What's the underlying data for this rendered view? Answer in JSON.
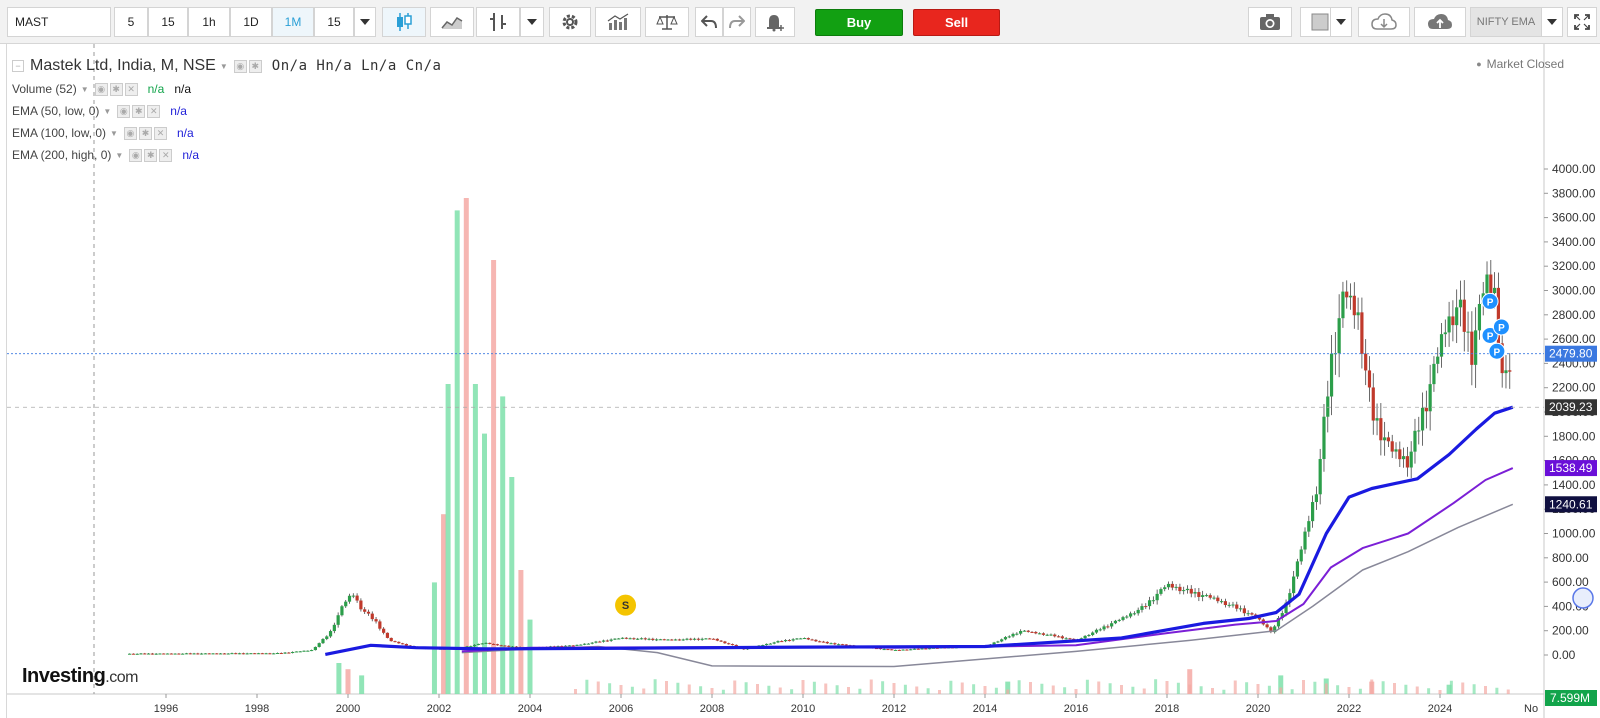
{
  "toolbar": {
    "symbol": "MAST",
    "timeframes": [
      "5",
      "15",
      "1h",
      "1D",
      "1M",
      "15"
    ],
    "active_timeframe": "1M",
    "buy_label": "Buy",
    "sell_label": "Sell",
    "compare_label": "NIFTY EMA",
    "buy_color": "#12a012",
    "sell_color": "#e8261e"
  },
  "legend": {
    "title": "Mastek Ltd, India, M, NSE",
    "ohlc": "On/a  Hn/a  Ln/a  Cn/a",
    "indicators": [
      {
        "label": "Volume (52)",
        "v1": "n/a",
        "v2": "n/a",
        "c1": "#12a44b",
        "c2": "#111111"
      },
      {
        "label": "EMA (50, low, 0)",
        "v1": "n/a",
        "c1": "#1e1ed8"
      },
      {
        "label": "EMA (100, low, 0)",
        "v1": "n/a",
        "c1": "#1e1ed8"
      },
      {
        "label": "EMA (200, high, 0)",
        "v1": "n/a",
        "c1": "#1e1ed8"
      }
    ]
  },
  "status": {
    "market": "Market Closed"
  },
  "branding": {
    "logo": "Investing",
    "logo_suffix": ".com"
  },
  "chart_data": {
    "type": "candlestick",
    "title": "Mastek Ltd, India, M, NSE",
    "ylim": [
      -100,
      4100
    ],
    "y_ticks": [
      0,
      200,
      400,
      600,
      800,
      1000,
      1200,
      1400,
      1600,
      1800,
      2000,
      2200,
      2400,
      2600,
      2800,
      3000,
      3200,
      3400,
      3600,
      3800,
      4000
    ],
    "y_tick_labels": [
      "0.00",
      "200.00",
      "400.00",
      "600.00",
      "800.00",
      "1000.00",
      "1200.00",
      "1400.00",
      "1600.00",
      "1800.00",
      "2000.00",
      "2200.00",
      "2400.00",
      "2600.00",
      "2800.00",
      "3000.00",
      "3200.00",
      "3400.00",
      "3600.00",
      "3800.00",
      "4000.00"
    ],
    "x_ticks": [
      1996,
      1998,
      2000,
      2002,
      2004,
      2006,
      2008,
      2010,
      2012,
      2014,
      2016,
      2018,
      2020,
      2022,
      2024
    ],
    "x_tick_labels": [
      "1996",
      "1998",
      "2000",
      "2002",
      "2004",
      "2006",
      "2008",
      "2010",
      "2012",
      "2014",
      "2016",
      "2018",
      "2020",
      "2022",
      "2024",
      "No"
    ],
    "xlim": [
      1994.9,
      2025.9
    ],
    "price_points": [
      [
        1995.2,
        10
      ],
      [
        1997.0,
        12
      ],
      [
        1998.5,
        14
      ],
      [
        1999.2,
        40
      ],
      [
        1999.6,
        180
      ],
      [
        1999.9,
        420
      ],
      [
        2000.1,
        510
      ],
      [
        2000.3,
        380
      ],
      [
        2000.6,
        280
      ],
      [
        2000.9,
        120
      ],
      [
        2001.5,
        60
      ],
      [
        2002.0,
        50
      ],
      [
        2002.5,
        60
      ],
      [
        2003.0,
        100
      ],
      [
        2003.5,
        70
      ],
      [
        2004.0,
        60
      ],
      [
        2005.0,
        80
      ],
      [
        2006.0,
        140
      ],
      [
        2007.0,
        125
      ],
      [
        2008.0,
        135
      ],
      [
        2008.7,
        50
      ],
      [
        2009.5,
        115
      ],
      [
        2010.0,
        140
      ],
      [
        2010.5,
        100
      ],
      [
        2011.0,
        80
      ],
      [
        2012.0,
        40
      ],
      [
        2013.0,
        60
      ],
      [
        2014.0,
        70
      ],
      [
        2014.8,
        200
      ],
      [
        2015.5,
        160
      ],
      [
        2016.0,
        120
      ],
      [
        2017.0,
        300
      ],
      [
        2017.5,
        400
      ],
      [
        2018.0,
        580
      ],
      [
        2018.6,
        510
      ],
      [
        2019.0,
        470
      ],
      [
        2019.6,
        380
      ],
      [
        2020.0,
        300
      ],
      [
        2020.3,
        190
      ],
      [
        2020.6,
        400
      ],
      [
        2020.9,
        800
      ],
      [
        2021.3,
        1400
      ],
      [
        2021.6,
        2400
      ],
      [
        2021.9,
        3000
      ],
      [
        2022.2,
        2800
      ],
      [
        2022.5,
        2000
      ],
      [
        2022.9,
        1700
      ],
      [
        2023.3,
        1600
      ],
      [
        2023.7,
        2100
      ],
      [
        2024.1,
        2700
      ],
      [
        2024.4,
        2900
      ],
      [
        2024.7,
        2500
      ],
      [
        2025.0,
        3100
      ],
      [
        2025.2,
        3000
      ],
      [
        2025.4,
        2200
      ],
      [
        2025.6,
        2480
      ]
    ],
    "ema_50_points": [
      [
        1999.5,
        5
      ],
      [
        2000.5,
        80
      ],
      [
        2001.5,
        60
      ],
      [
        2003,
        50
      ],
      [
        2006,
        55
      ],
      [
        2010,
        65
      ],
      [
        2014,
        70
      ],
      [
        2017,
        140
      ],
      [
        2018.8,
        260
      ],
      [
        2019.8,
        300
      ],
      [
        2020.4,
        350
      ],
      [
        2020.9,
        500
      ],
      [
        2021.5,
        1000
      ],
      [
        2022.0,
        1300
      ],
      [
        2022.5,
        1370
      ],
      [
        2023.5,
        1450
      ],
      [
        2024.2,
        1650
      ],
      [
        2024.8,
        1860
      ],
      [
        2025.2,
        1990
      ],
      [
        2025.6,
        2039.23
      ]
    ],
    "ema_100_points": [
      [
        2002.5,
        30
      ],
      [
        2004,
        60
      ],
      [
        2008,
        65
      ],
      [
        2012,
        60
      ],
      [
        2016,
        80
      ],
      [
        2018.0,
        180
      ],
      [
        2019.5,
        250
      ],
      [
        2020.4,
        280
      ],
      [
        2021.0,
        420
      ],
      [
        2021.6,
        720
      ],
      [
        2022.3,
        880
      ],
      [
        2023.3,
        1000
      ],
      [
        2024.3,
        1250
      ],
      [
        2025.0,
        1440
      ],
      [
        2025.6,
        1538.49
      ]
    ],
    "ema_200_points": [
      [
        2002.5,
        20
      ],
      [
        2003.5,
        40
      ],
      [
        2005.5,
        70
      ],
      [
        2006.8,
        20
      ],
      [
        2008,
        -90
      ],
      [
        2012,
        -95
      ],
      [
        2016,
        30
      ],
      [
        2018.5,
        120
      ],
      [
        2020.4,
        200
      ],
      [
        2021.2,
        400
      ],
      [
        2022.3,
        700
      ],
      [
        2023.3,
        850
      ],
      [
        2024.4,
        1050
      ],
      [
        2025.6,
        1240.61
      ]
    ],
    "price_markers": [
      {
        "label": "2479.80",
        "value": 2479.8,
        "color": "#3a78e0"
      },
      {
        "label": "2039.23",
        "value": 2039.23,
        "color": "#333333"
      },
      {
        "label": "1538.49",
        "value": 1538.49,
        "color": "#6a0fd8"
      },
      {
        "label": "1240.61",
        "value": 1240.61,
        "color": "#101040"
      }
    ],
    "volume_marker": {
      "label": "7.599M",
      "color": "#12a44b"
    },
    "event_markers": [
      {
        "label": "S",
        "year": 2006.1,
        "value": 410,
        "color": "#f4c400"
      },
      {
        "label": "P",
        "year": 2025.1,
        "value": 2910,
        "color": "#1e90ff"
      },
      {
        "label": "P",
        "year": 2025.1,
        "value": 2630,
        "color": "#1e90ff"
      },
      {
        "label": "P",
        "year": 2025.35,
        "value": 2700,
        "color": "#1e90ff"
      },
      {
        "label": "P",
        "year": 2025.25,
        "value": 2500,
        "color": "#1e90ff"
      }
    ],
    "volume_bars": [
      [
        2001.9,
        180
      ],
      [
        2002.1,
        290
      ],
      [
        2002.2,
        500
      ],
      [
        2002.4,
        780
      ],
      [
        2002.6,
        800
      ],
      [
        2002.8,
        500
      ],
      [
        2003.0,
        420
      ],
      [
        2003.2,
        700
      ],
      [
        2003.4,
        480
      ],
      [
        2003.6,
        350
      ],
      [
        2003.8,
        200
      ],
      [
        2004.0,
        120
      ],
      [
        1999.8,
        50
      ],
      [
        2000.0,
        40
      ],
      [
        2000.3,
        30
      ],
      [
        2014.5,
        20
      ],
      [
        2018.5,
        40
      ],
      [
        2020.5,
        30
      ],
      [
        2021.5,
        25
      ],
      [
        2022.5,
        20
      ],
      [
        2024.2,
        15
      ]
    ],
    "colors": {
      "up": "#2c9e4a",
      "down": "#c0392b",
      "ema50": "#1a1ae0",
      "ema100": "#7b1fd6",
      "ema200": "#888899",
      "vol_up": "#7ee0aa",
      "vol_down": "#f4a9a4"
    }
  }
}
